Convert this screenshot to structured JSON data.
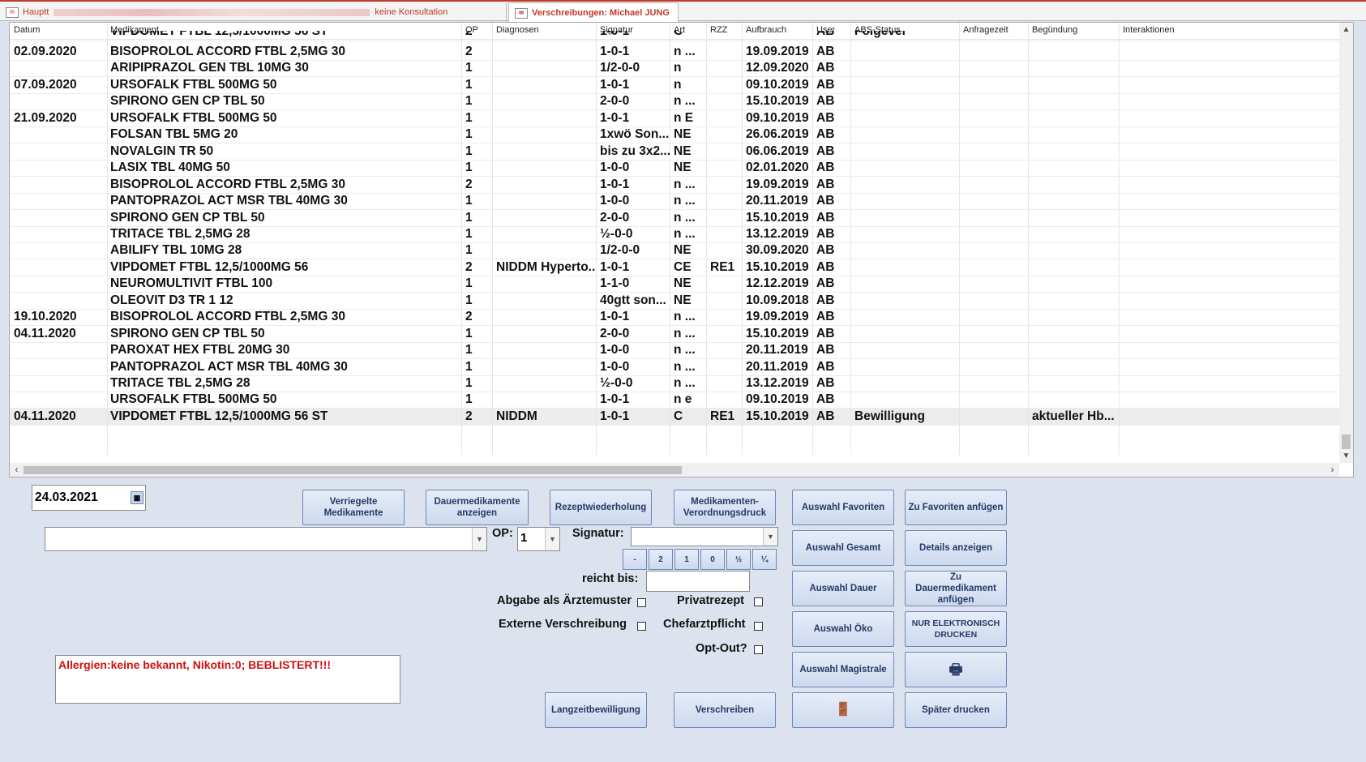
{
  "tabs": [
    {
      "label_start": "Hauptt",
      "label_end": "keine Konsultation"
    },
    {
      "label": "Verschreibungen: Michael JUNG"
    }
  ],
  "grid": {
    "columns": [
      "Datum",
      "Medikament",
      "OP",
      "Diagnosen",
      "Signatur",
      "Art",
      "RZZ",
      "Aufbrauch",
      "User",
      "ABS-Status",
      "Anfragezeit",
      "Begündung",
      "Interaktionen"
    ],
    "top_partial": {
      "medikament": "VIPDOMET FTBL 12,5/1000MG 56 ST",
      "op": "2",
      "signatur": "1-0-1",
      "art": "C",
      "user": "AB",
      "abs": "Folgever"
    },
    "rows": [
      {
        "datum": "02.09.2020",
        "medikament": "BISOPROLOL ACCORD FTBL 2,5MG 30",
        "op": "2",
        "diag": "",
        "sig": "1-0-1",
        "art": "n   ...",
        "rzz": "",
        "aufbrauch": "19.09.2019",
        "user": "AB",
        "abs": "",
        "begr": ""
      },
      {
        "datum": "",
        "medikament": "ARIPIPRAZOL GEN TBL 10MG 30",
        "op": "1",
        "diag": "",
        "sig": "1/2-0-0",
        "art": "n",
        "rzz": "",
        "aufbrauch": "12.09.2020",
        "user": "AB",
        "abs": "",
        "begr": ""
      },
      {
        "datum": "07.09.2020",
        "medikament": "URSOFALK FTBL 500MG 50",
        "op": "1",
        "diag": "",
        "sig": "1-0-1",
        "art": "n",
        "rzz": "",
        "aufbrauch": "09.10.2019",
        "user": "AB",
        "abs": "",
        "begr": ""
      },
      {
        "datum": "",
        "medikament": "SPIRONO GEN CP TBL 50",
        "op": "1",
        "diag": "",
        "sig": "2-0-0",
        "art": "n   ...",
        "rzz": "",
        "aufbrauch": "15.10.2019",
        "user": "AB",
        "abs": "",
        "begr": ""
      },
      {
        "datum": "21.09.2020",
        "medikament": "URSOFALK FTBL 500MG 50",
        "op": "1",
        "diag": "",
        "sig": "1-0-1",
        "art": "n  E",
        "rzz": "",
        "aufbrauch": "09.10.2019",
        "user": "AB",
        "abs": "",
        "begr": ""
      },
      {
        "datum": "",
        "medikament": "FOLSAN TBL 5MG 20",
        "op": "1",
        "diag": "",
        "sig": "1xwö Son...",
        "art": "NE",
        "rzz": "",
        "aufbrauch": "26.06.2019",
        "user": "AB",
        "abs": "",
        "begr": ""
      },
      {
        "datum": "",
        "medikament": "NOVALGIN TR 50",
        "op": "1",
        "diag": "",
        "sig": "bis zu 3x2...",
        "art": "NE",
        "rzz": "",
        "aufbrauch": "06.06.2019",
        "user": "AB",
        "abs": "",
        "begr": ""
      },
      {
        "datum": "",
        "medikament": "LASIX TBL  40MG 50",
        "op": "1",
        "diag": "",
        "sig": "1-0-0",
        "art": "NE",
        "rzz": "",
        "aufbrauch": "02.01.2020",
        "user": "AB",
        "abs": "",
        "begr": ""
      },
      {
        "datum": "",
        "medikament": "BISOPROLOL ACCORD FTBL 2,5MG 30",
        "op": "2",
        "diag": "",
        "sig": "1-0-1",
        "art": "n   ...",
        "rzz": "",
        "aufbrauch": "19.09.2019",
        "user": "AB",
        "abs": "",
        "begr": ""
      },
      {
        "datum": "",
        "medikament": "PANTOPRAZOL ACT MSR TBL 40MG 30",
        "op": "1",
        "diag": "",
        "sig": "1-0-0",
        "art": "n   ...",
        "rzz": "",
        "aufbrauch": "20.11.2019",
        "user": "AB",
        "abs": "",
        "begr": ""
      },
      {
        "datum": "",
        "medikament": "SPIRONO GEN CP TBL 50",
        "op": "1",
        "diag": "",
        "sig": "2-0-0",
        "art": "n   ...",
        "rzz": "",
        "aufbrauch": "15.10.2019",
        "user": "AB",
        "abs": "",
        "begr": ""
      },
      {
        "datum": "",
        "medikament": "TRITACE TBL  2,5MG 28",
        "op": "1",
        "diag": "",
        "sig": "½-0-0",
        "art": "n   ...",
        "rzz": "",
        "aufbrauch": "13.12.2019",
        "user": "AB",
        "abs": "",
        "begr": ""
      },
      {
        "datum": "",
        "medikament": "ABILIFY TBL 10MG 28",
        "op": "1",
        "diag": "",
        "sig": "1/2-0-0",
        "art": "NE",
        "rzz": "",
        "aufbrauch": "30.09.2020",
        "user": "AB",
        "abs": "",
        "begr": ""
      },
      {
        "datum": "",
        "medikament": "VIPDOMET FTBL 12,5/1000MG 56",
        "op": "2",
        "diag": "NIDDM Hyperto...",
        "sig": "1-0-1",
        "art": "CE",
        "rzz": "RE1",
        "aufbrauch": "15.10.2019",
        "user": "AB",
        "abs": "",
        "begr": ""
      },
      {
        "datum": "",
        "medikament": "NEUROMULTIVIT FTBL 100",
        "op": "1",
        "diag": "",
        "sig": "1-1-0",
        "art": "NE",
        "rzz": "",
        "aufbrauch": "12.12.2019",
        "user": "AB",
        "abs": "",
        "begr": ""
      },
      {
        "datum": "",
        "medikament": "OLEOVIT D3 TR               1 12",
        "op": "1",
        "diag": "",
        "sig": "40gtt son...",
        "art": "NE",
        "rzz": "",
        "aufbrauch": "10.09.2018",
        "user": "AB",
        "abs": "",
        "begr": ""
      },
      {
        "datum": "19.10.2020",
        "medikament": "BISOPROLOL ACCORD FTBL 2,5MG 30",
        "op": "2",
        "diag": "",
        "sig": "1-0-1",
        "art": "n   ...",
        "rzz": "",
        "aufbrauch": "19.09.2019",
        "user": "AB",
        "abs": "",
        "begr": ""
      },
      {
        "datum": "04.11.2020",
        "medikament": "SPIRONO GEN CP TBL 50",
        "op": "1",
        "diag": "",
        "sig": "2-0-0",
        "art": "n   ...",
        "rzz": "",
        "aufbrauch": "15.10.2019",
        "user": "AB",
        "abs": "",
        "begr": ""
      },
      {
        "datum": "",
        "medikament": "PAROXAT HEX FTBL 20MG 30",
        "op": "1",
        "diag": "",
        "sig": "1-0-0",
        "art": "n   ...",
        "rzz": "",
        "aufbrauch": "20.11.2019",
        "user": "AB",
        "abs": "",
        "begr": ""
      },
      {
        "datum": "",
        "medikament": "PANTOPRAZOL ACT MSR TBL 40MG 30",
        "op": "1",
        "diag": "",
        "sig": "1-0-0",
        "art": "n   ...",
        "rzz": "",
        "aufbrauch": "20.11.2019",
        "user": "AB",
        "abs": "",
        "begr": ""
      },
      {
        "datum": "",
        "medikament": "TRITACE TBL  2,5MG 28",
        "op": "1",
        "diag": "",
        "sig": "½-0-0",
        "art": "n   ...",
        "rzz": "",
        "aufbrauch": "13.12.2019",
        "user": "AB",
        "abs": "",
        "begr": ""
      },
      {
        "datum": "",
        "medikament": "URSOFALK FTBL 500MG 50",
        "op": "1",
        "diag": "",
        "sig": "1-0-1",
        "art": "n  e",
        "rzz": "",
        "aufbrauch": "09.10.2019",
        "user": "AB",
        "abs": "",
        "begr": ""
      },
      {
        "datum": "04.11.2020",
        "medikament": "VIPDOMET FTBL 12,5/1000MG 56 ST",
        "op": "2",
        "diag": "NIDDM",
        "sig": "1-0-1",
        "art": "C",
        "rzz": "RE1",
        "aufbrauch": "15.10.2019",
        "user": "AB",
        "abs": "Bewilligung",
        "begr": "aktueller Hb..."
      }
    ]
  },
  "form": {
    "date": "24.03.2021",
    "medication_value": "",
    "op_label": "OP:",
    "op_value": "1",
    "signatur_label": "Signatur:",
    "signatur_value": "",
    "sig_buttons": [
      "-",
      "2",
      "1",
      "0",
      "½",
      "¼"
    ],
    "reicht_bis_label": "reicht bis:",
    "reicht_bis_value": "",
    "abgabe_label": "Abgabe als Ärztemuster",
    "externe_label": "Externe Verschreibung",
    "privat_label": "Privatrezept",
    "chefarzt_label": "Chefarztpflicht",
    "optout_label": "Opt-Out?",
    "allergy_text": "Allergien:keine bekannt, Nikotin:0; BEBLISTERT!!!"
  },
  "buttons": {
    "verriegelte": [
      "Verriegelte",
      "Medikamente"
    ],
    "dauer_anzeigen": [
      "Dauermedikamente",
      "anzeigen"
    ],
    "rezeptwiederholung": "Rezeptwiederholung",
    "verordnungsdruck": [
      "Medikamenten-",
      "Verordnungsdruck"
    ],
    "auswahl_favoriten": "Auswahl Favoriten",
    "zu_favoriten": "Zu Favoriten anfügen",
    "auswahl_gesamt": "Auswahl Gesamt",
    "details": "Details anzeigen",
    "auswahl_dauer": "Auswahl Dauer",
    "zu_dauer": [
      "Zu",
      "Dauermedikament",
      "anfügen"
    ],
    "auswahl_oko": "Auswahl Öko",
    "nur_elektronisch": [
      "NUR ELEKTRONISCH",
      "DRUCKEN"
    ],
    "auswahl_magistrale": "Auswahl Magistrale",
    "print_icon": "🖶",
    "langzeit": "Langzeitbewilligung",
    "verschreiben": "Verschreiben",
    "exit_icon": "🚪",
    "spaeter": "Später drucken"
  },
  "colors": {
    "accent": "#c0392b",
    "button_text": "#243a66",
    "allergy": "#d01010",
    "background": "#dde3ee"
  }
}
